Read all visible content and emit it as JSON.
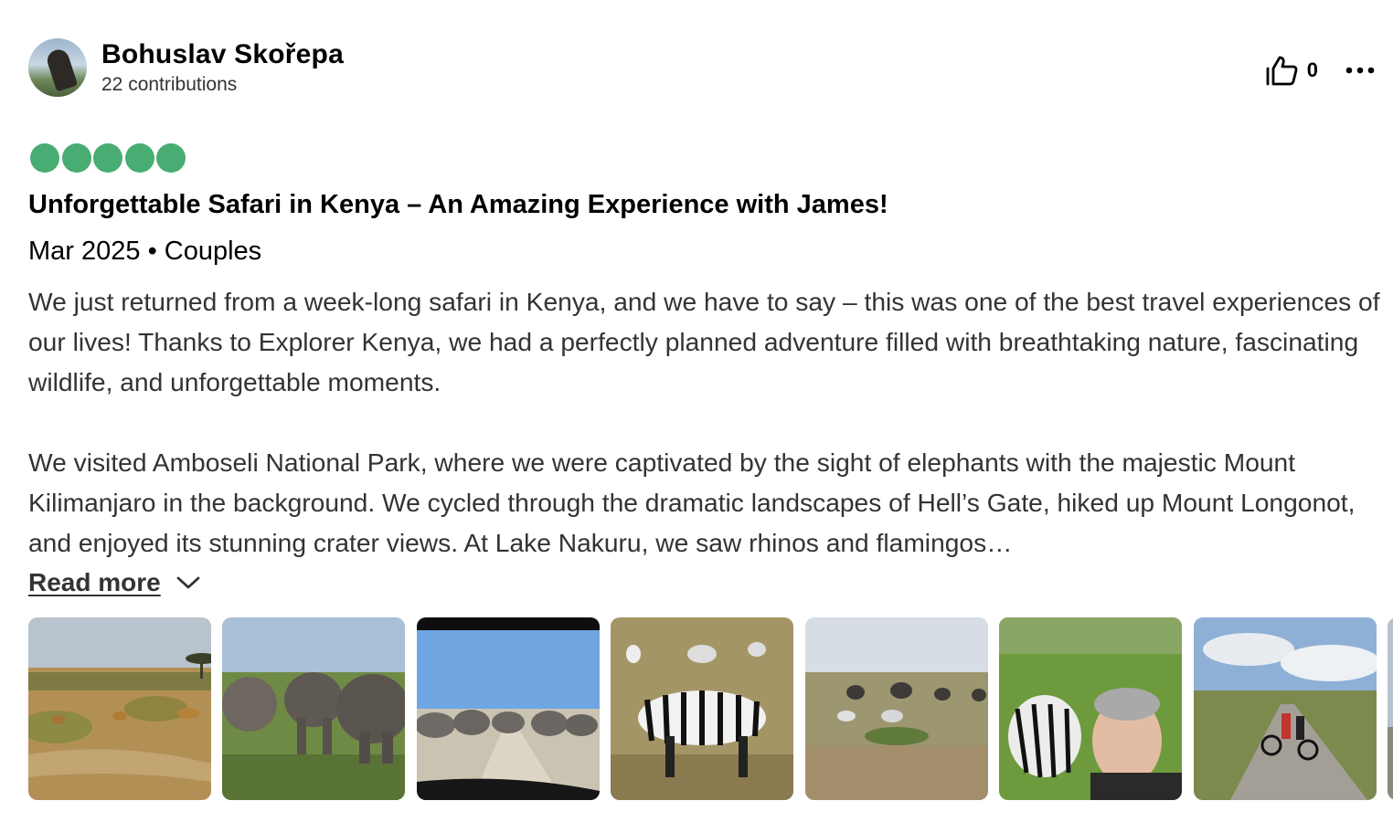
{
  "reviewer": {
    "name": "Bohuslav Skořepa",
    "contributions": "22 contributions"
  },
  "actions": {
    "helpful_count": "0",
    "helpful_icon": "thumbs-up-icon",
    "more_icon": "more-options-icon"
  },
  "rating": {
    "value": 5,
    "max": 5,
    "color": "#48ad72"
  },
  "review": {
    "title": "Unforgettable Safari in Kenya – An Amazing Experience with James!",
    "meta": "Mar 2025 • Couples",
    "paragraph1": "We just returned from a week-long safari in Kenya, and we have to say – this was one of the best travel experiences of our lives! Thanks to Explorer Kenya, we had a perfectly planned adventure filled with breathtaking nature, fascinating wildlife, and unforgettable moments.",
    "paragraph2": "We visited Amboseli National Park, where we were captivated by the sight of elephants with the majestic Mount Kilimanjaro in the background. We cycled through the dramatic landscapes of Hell’s Gate, hiked up Mount Longonot, and enjoyed its stunning crater views. At Lake Nakuru, we saw rhinos and flamingos…",
    "read_more": "Read more",
    "read_more_icon": "chevron-down-icon"
  },
  "photos": [
    {
      "subject": "lions-savanna-photo"
    },
    {
      "subject": "elephant-herd-photo"
    },
    {
      "subject": "elephants-crossing-road-photo"
    },
    {
      "subject": "zebras-grazing-photo"
    },
    {
      "subject": "zebras-elephants-plain-photo"
    },
    {
      "subject": "zebras-selfie-photo"
    },
    {
      "subject": "cyclists-road-photo"
    },
    {
      "subject": "person-portrait-photo"
    }
  ]
}
